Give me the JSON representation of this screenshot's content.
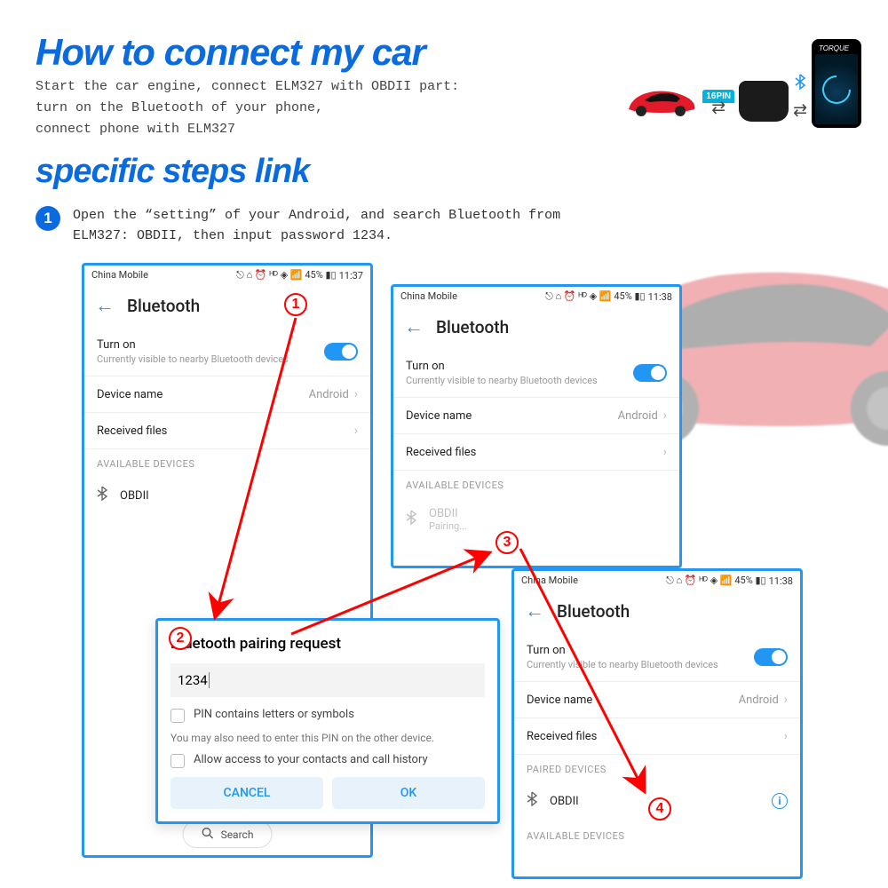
{
  "title1": "How to connect my car",
  "intro": "Start the car engine, connect ELM327 with OBDII part:\nturn on the Bluetooth of your phone,\nconnect phone with ELM327",
  "diagram": {
    "pinlabel": "16PIN",
    "torque": "TORQUE"
  },
  "title2": "specific steps link",
  "step1": {
    "num": "1",
    "text": "Open the “setting” of your Android, and search Bluetooth from ELM327: OBDII, then input password 1234."
  },
  "status": {
    "carrier": "China Mobile",
    "icons": "⚇ ♪ ⌁ Ⓗ ▶ ❖ 45%  ■□",
    "t1": "11:37",
    "t2": "11:38",
    "t3": "11:38"
  },
  "bt": {
    "title": "Bluetooth",
    "turnon": "Turn on",
    "visible": "Currently visible to nearby Bluetooth devices",
    "devname_label": "Device name",
    "devname_value": "Android",
    "received": "Received files",
    "avail": "AVAILABLE DEVICES",
    "paired": "PAIRED DEVICES",
    "obdii": "OBDII",
    "pairing": "Pairing...",
    "search": "Search"
  },
  "dialog": {
    "title": "Bluetooth pairing request",
    "pin": "1234",
    "chk1": "PIN contains letters or symbols",
    "hint": "You may also need to enter this PIN on the other device.",
    "chk2": "Allow access to your contacts and call history",
    "cancel": "CANCEL",
    "ok": "OK"
  },
  "red": {
    "r1": "1",
    "r2": "2",
    "r3": "3",
    "r4": "4"
  }
}
